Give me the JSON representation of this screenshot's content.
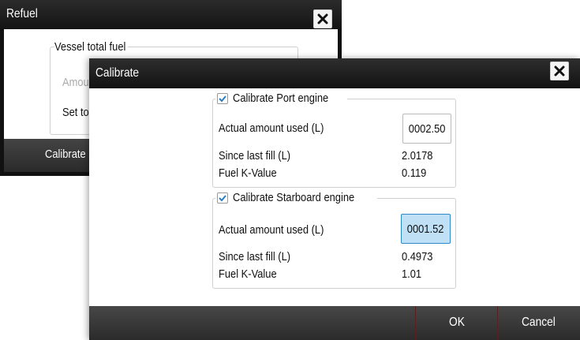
{
  "refuel": {
    "title": "Refuel",
    "close_icon": "close-icon",
    "group_title": "Vessel total fuel",
    "amount_label": "Amou",
    "set_to_label": "Set to",
    "calibrate_button": "Calibrate"
  },
  "calibrate": {
    "title": "Calibrate",
    "close_icon": "close-icon",
    "port": {
      "checkbox_label": "Calibrate Port engine",
      "checked": true,
      "actual_label": "Actual amount used (L)",
      "actual_value": "0002.50",
      "since_label": "Since last fill (L)",
      "since_value": "2.0178",
      "k_label": "Fuel K-Value",
      "k_value": "0.119"
    },
    "starboard": {
      "checkbox_label": "Calibrate Starboard engine",
      "checked": true,
      "actual_label": "Actual amount used (L)",
      "actual_value": "0001.52",
      "since_label": "Since last fill (L)",
      "since_value": "0.4973",
      "k_label": "Fuel K-Value",
      "k_value": "1.01"
    },
    "ok_button": "OK",
    "cancel_button": "Cancel"
  },
  "colors": {
    "focus_fill": "#bfe0f5",
    "focus_border": "#2f88c8",
    "check": "#2a7fc4"
  }
}
